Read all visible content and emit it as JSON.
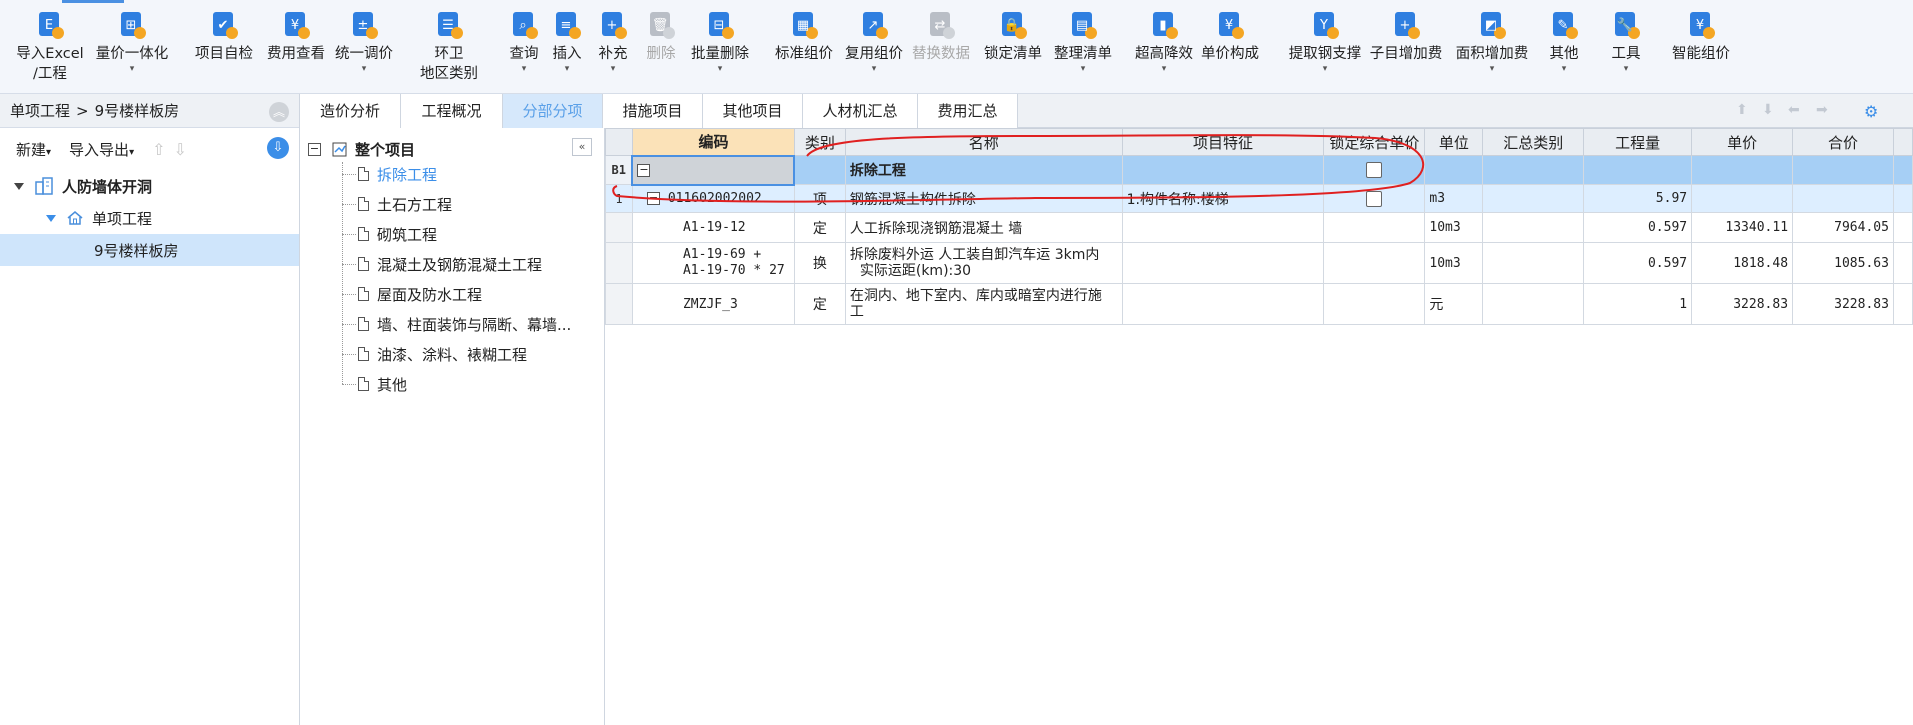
{
  "toolbar": {
    "items": [
      {
        "label": "导入Excel",
        "label2": "/工程",
        "icon": "excel-import-icon"
      },
      {
        "label": "量价一体化",
        "icon": "quantity-price-icon",
        "dropdown": true
      },
      {
        "label": "项目自检",
        "icon": "self-check-icon"
      },
      {
        "label": "费用查看",
        "icon": "fee-view-icon"
      },
      {
        "label": "统一调价",
        "icon": "adjust-price-icon",
        "dropdown": true
      },
      {
        "label": "环卫",
        "label2": "地区类别",
        "icon": "region-icon"
      },
      {
        "label": "查询",
        "icon": "query-icon",
        "dropdown": true
      },
      {
        "label": "插入",
        "icon": "insert-icon",
        "dropdown": true
      },
      {
        "label": "补充",
        "icon": "supplement-icon",
        "dropdown": true
      },
      {
        "label": "删除",
        "icon": "delete-icon",
        "disabled": true
      },
      {
        "label": "批量删除",
        "icon": "batch-delete-icon",
        "dropdown": true
      },
      {
        "label": "标准组价",
        "icon": "standard-price-icon"
      },
      {
        "label": "复用组价",
        "icon": "reuse-price-icon",
        "dropdown": true
      },
      {
        "label": "替换数据",
        "icon": "replace-data-icon",
        "disabled": true
      },
      {
        "label": "锁定清单",
        "icon": "lock-icon"
      },
      {
        "label": "整理清单",
        "icon": "organize-list-icon",
        "dropdown": true
      },
      {
        "label": "超高降效",
        "icon": "high-rise-icon",
        "dropdown": true
      },
      {
        "label": "单价构成",
        "icon": "unit-price-icon"
      },
      {
        "label": "提取钢支撑",
        "icon": "steel-support-icon",
        "dropdown": true
      },
      {
        "label": "子目增加费",
        "icon": "sub-fee-icon"
      },
      {
        "label": "面积增加费",
        "icon": "area-fee-icon",
        "dropdown": true
      },
      {
        "label": "其他",
        "icon": "other-icon",
        "dropdown": true
      },
      {
        "label": "工具",
        "icon": "tools-icon",
        "dropdown": true
      },
      {
        "label": "智能组价",
        "icon": "smart-price-icon"
      }
    ]
  },
  "left": {
    "breadcrumb_root": "单项工程",
    "breadcrumb_sep": ">",
    "breadcrumb_leaf": "9号楼样板房",
    "new_label": "新建",
    "import_export_label": "导入导出",
    "tree": {
      "root": "人防墙体开洞",
      "child": "单项工程",
      "leaf": "9号楼样板房"
    }
  },
  "tabs": [
    "造价分析",
    "工程概况",
    "分部分项",
    "措施项目",
    "其他项目",
    "人材机汇总",
    "费用汇总"
  ],
  "active_tab": "分部分项",
  "midtree": {
    "root": "整个项目",
    "items": [
      "拆除工程",
      "土石方工程",
      "砌筑工程",
      "混凝土及钢筋混凝土工程",
      "屋面及防水工程",
      "墙、柱面装饰与隔断、幕墙...",
      "油漆、涂料、裱糊工程",
      "其他"
    ]
  },
  "grid": {
    "columns": [
      "编码",
      "类别",
      "名称",
      "项目特征",
      "锁定综合单价",
      "单位",
      "汇总类别",
      "工程量",
      "单价",
      "合价"
    ],
    "group": {
      "rn": "B1",
      "name": "拆除工程"
    },
    "main": {
      "rn": "1",
      "code": "011602002002",
      "type": "项",
      "name": "钢筋混凝土构件拆除",
      "feature": "1.构件名称:楼梯",
      "unit": "m3",
      "qty": "5.97"
    },
    "rows": [
      {
        "code": "A1-19-12",
        "type": "定",
        "name": "人工拆除现浇钢筋混凝土 墙",
        "unit": "10m3",
        "qty": "0.597",
        "price": "13340.11",
        "total": "7964.05"
      },
      {
        "code": "A1-19-69 +",
        "code2": "A1-19-70 * 27",
        "type": "换",
        "name": "拆除废料外运 人工装自卸汽车运 3km内",
        "name2": "实际运距(km):30",
        "unit": "10m3",
        "qty": "0.597",
        "price": "1818.48",
        "total": "1085.63"
      },
      {
        "code": "ZMZJF_3",
        "type": "定",
        "name": "在洞内、地下室内、库内或暗室内进行施",
        "name2": "工",
        "unit": "元",
        "qty": "1",
        "price": "3228.83",
        "total": "3228.83"
      }
    ]
  },
  "colors": {
    "accent": "#3b8ee8",
    "annotation": "#e02020",
    "selected_row": "#a6cff5"
  }
}
